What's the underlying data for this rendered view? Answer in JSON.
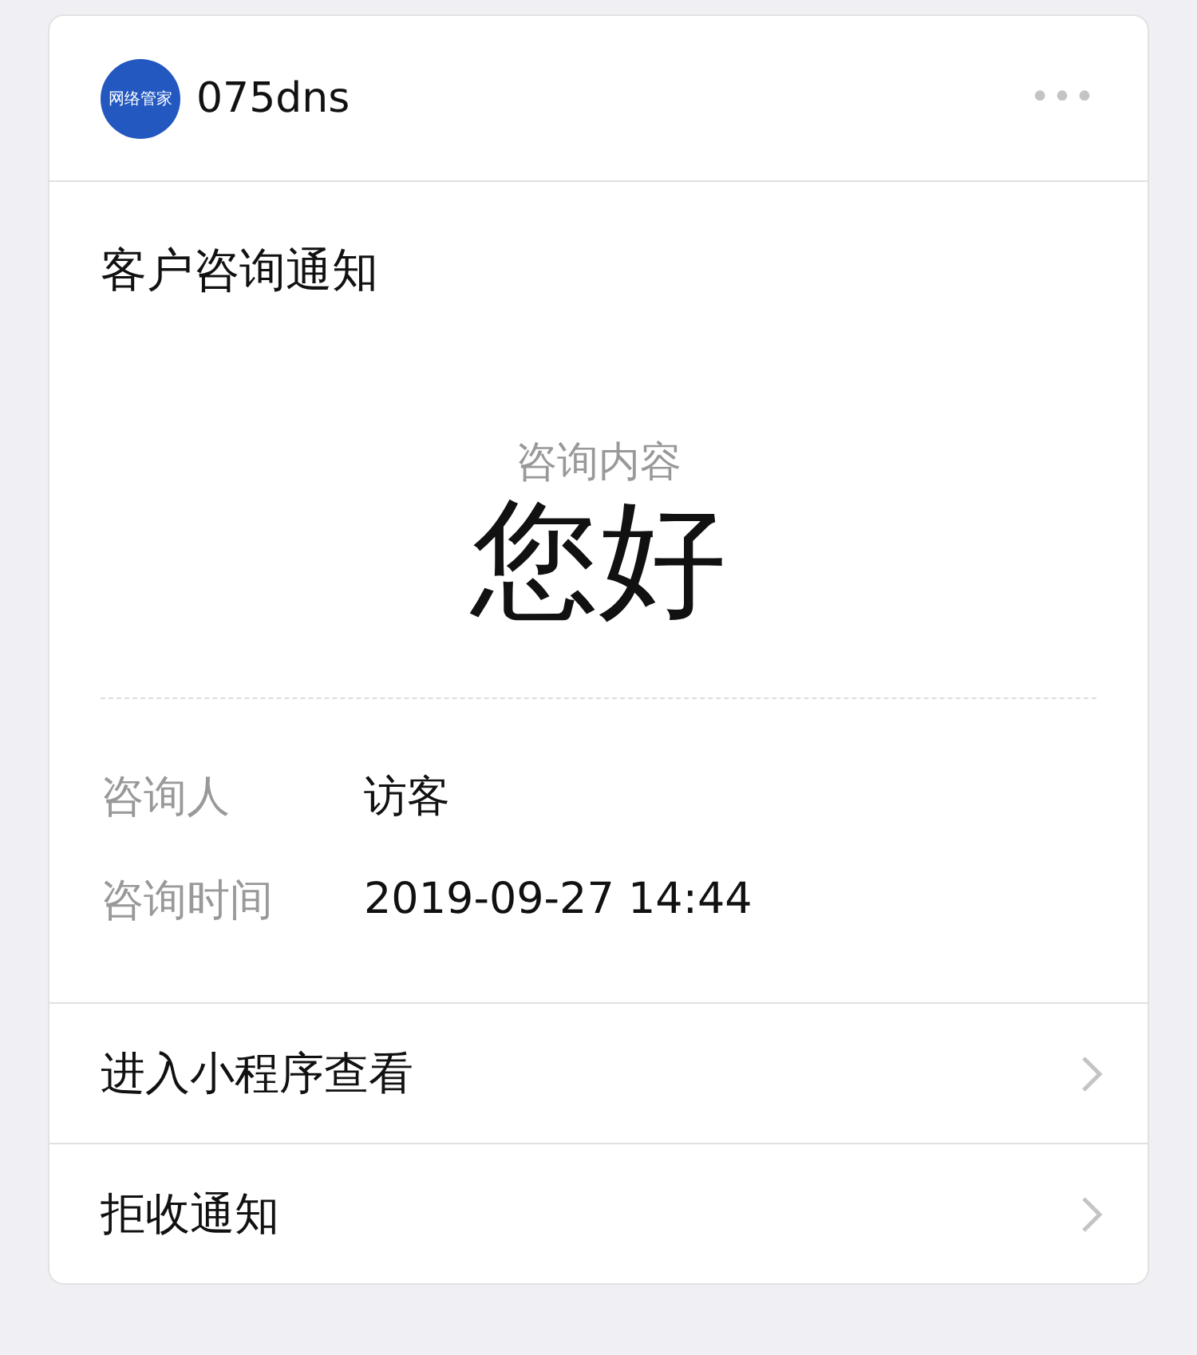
{
  "header": {
    "logo_text": "网络管家",
    "account": "075dns",
    "menu": "•••"
  },
  "title": "客户咨询通知",
  "content": {
    "label": "咨询内容",
    "value": "您好"
  },
  "fields": [
    {
      "label": "咨询人",
      "value": "访客"
    },
    {
      "label": "咨询时间",
      "value": "2019-09-27 14:44"
    }
  ],
  "actions": [
    {
      "label": "进入小程序查看"
    },
    {
      "label": "拒收通知"
    }
  ]
}
